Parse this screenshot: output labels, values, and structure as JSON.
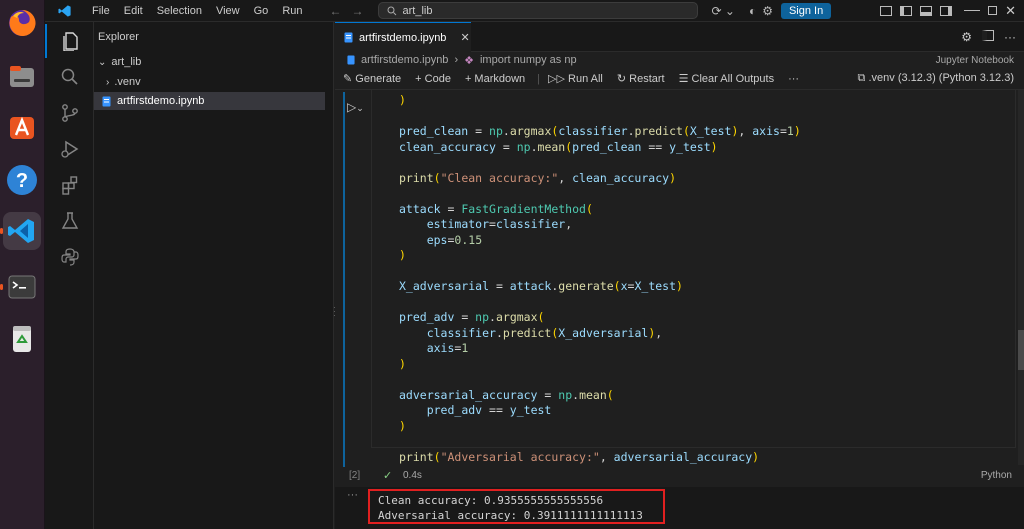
{
  "window": {
    "menu": [
      "File",
      "Edit",
      "Selection",
      "View",
      "Go",
      "Run"
    ],
    "search_text": "art_lib",
    "sign_in": "Sign In"
  },
  "sidebar": {
    "title": "Explorer",
    "folder": "art_lib",
    "items": [
      ".venv",
      "artfirstdemo.ipynb"
    ]
  },
  "editor": {
    "tab_label": "artfirstdemo.ipynb",
    "breadcrumb_file": "artfirstdemo.ipynb",
    "breadcrumb_symbol": "import numpy as np",
    "notebook_type": "Jupyter Notebook",
    "toolbar": {
      "generate": "Generate",
      "code": "Code",
      "markdown": "Markdown",
      "run_all": "Run All",
      "restart": "Restart",
      "clear_outputs": "Clear All Outputs",
      "more": "···",
      "kernel": ".venv (3.12.3) (Python 3.12.3)"
    },
    "cell": {
      "exec_count": "[2]",
      "duration": "0.4s",
      "language": "Python",
      "output_lines": [
        "Clean accuracy: 0.9355555555555556",
        "Adversarial accuracy: 0.3911111111111113"
      ]
    }
  },
  "colors": {
    "accent": "#0078d4",
    "highlight_box": "#e02020",
    "success": "#89d185"
  }
}
